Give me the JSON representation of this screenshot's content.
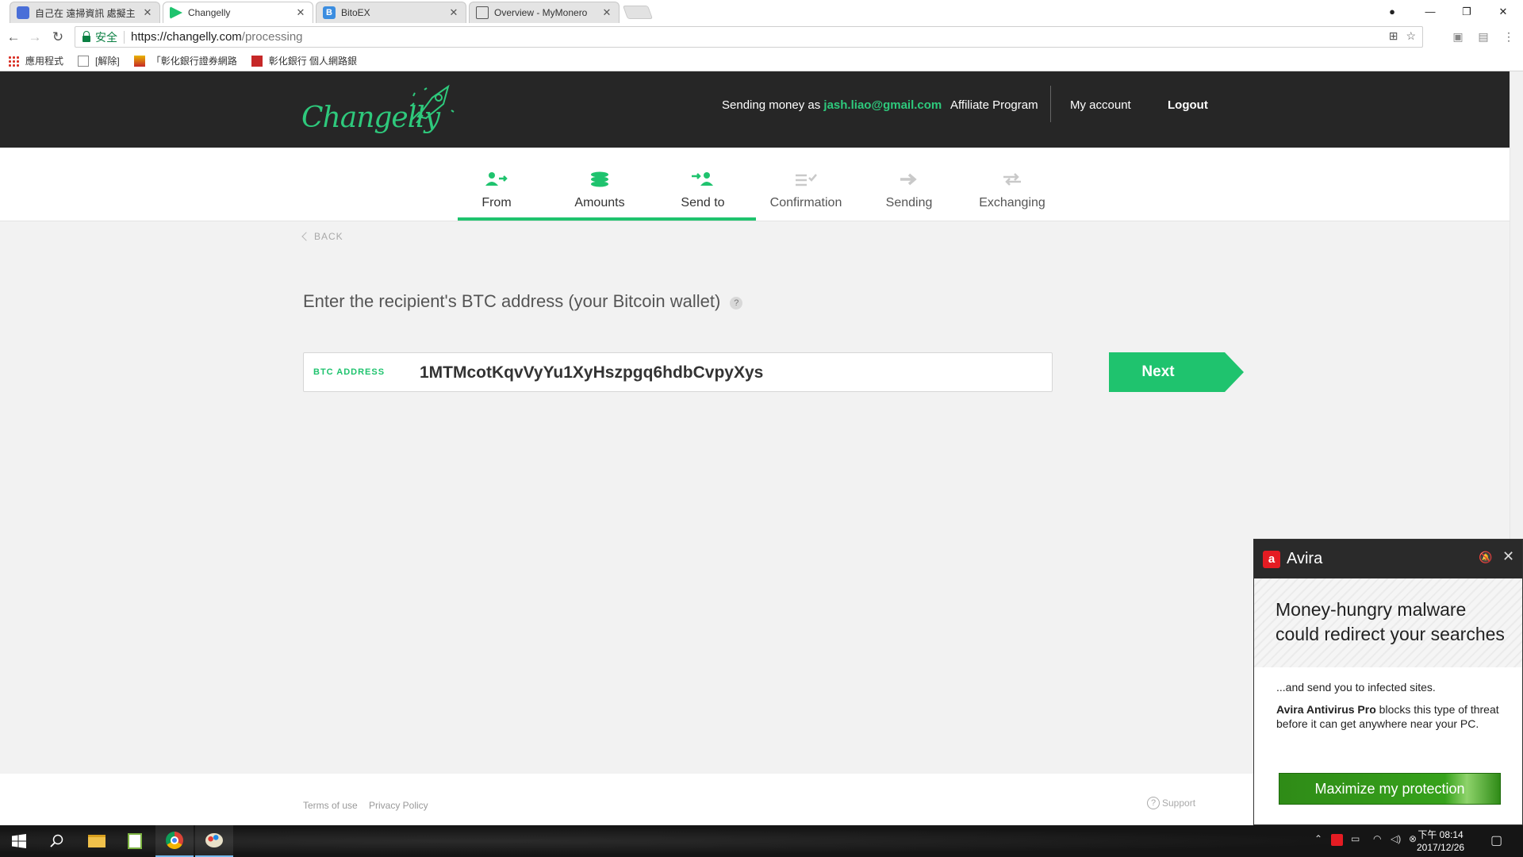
{
  "browser": {
    "tabs": [
      {
        "label": "自己在 遠掃資訊 處擬主"
      },
      {
        "label": "Changelly"
      },
      {
        "label": "BitoEX"
      },
      {
        "label": "Overview - MyMonero"
      }
    ],
    "secure_label": "安全",
    "url_host": "https://changelly.com",
    "url_path": "/processing",
    "bookmarks": [
      {
        "label": "應用程式"
      },
      {
        "label": "[解除]"
      },
      {
        "label": "「彰化銀行證券網路"
      },
      {
        "label": "彰化銀行 個人網路銀"
      }
    ]
  },
  "header": {
    "logo_text": "Changelly",
    "sending_prefix": "Sending money as ",
    "email": "jash.liao@gmail.com",
    "affiliate": "Affiliate Program",
    "account": "My account",
    "logout": "Logout"
  },
  "steps": [
    {
      "label": "From",
      "state": "done",
      "icon": "user-arrow-icon"
    },
    {
      "label": "Amounts",
      "state": "done",
      "icon": "coins-stack-icon"
    },
    {
      "label": "Send to",
      "state": "current",
      "icon": "send-to-user-icon"
    },
    {
      "label": "Confirmation",
      "state": "todo",
      "icon": "checklist-icon"
    },
    {
      "label": "Sending",
      "state": "todo",
      "icon": "arrow-right-icon"
    },
    {
      "label": "Exchanging",
      "state": "todo",
      "icon": "exchange-arrows-icon"
    }
  ],
  "main": {
    "back_label": "BACK",
    "prompt": "Enter the recipient's BTC address (your Bitcoin wallet)",
    "help_glyph": "?",
    "address_label": "BTC ADDRESS",
    "address_value": "1MTMcotKqvVyYu1XyHszpgq6hdbCvpyXys",
    "next_label": "Next"
  },
  "footer": {
    "terms": "Terms of use",
    "privacy": "Privacy Policy",
    "support": "Support"
  },
  "avira": {
    "title": "Avira",
    "headline_1": "Money-hungry malware",
    "headline_2": "could redirect your searches",
    "body_1": "...and send you to infected sites.",
    "body_2_bold": "Avira Antivirus Pro",
    "body_2_rest": " blocks this type of threat before it can get anywhere near your PC.",
    "button": "Maximize my protection"
  },
  "taskbar": {
    "time": "下午 08:14",
    "date": "2017/12/26"
  },
  "colors": {
    "accent": "#1fc36e",
    "header_bg": "#262626",
    "avira_red": "#e51c23",
    "avira_green": "#36a21b"
  }
}
